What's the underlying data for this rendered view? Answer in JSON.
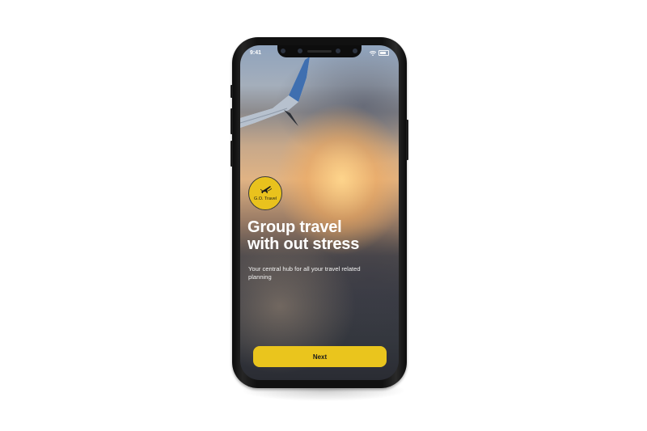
{
  "status_bar": {
    "time": "9:41"
  },
  "logo": {
    "name": "G.O. Travel",
    "icon": "airplane-icon"
  },
  "onboarding": {
    "headline_line1": "Group travel",
    "headline_line2": "with out stress",
    "subtitle": "Your central hub for all your travel related planning",
    "next_label": "Next"
  },
  "colors": {
    "accent": "#eac51d",
    "background": "#ffffff",
    "device": "#111111"
  }
}
